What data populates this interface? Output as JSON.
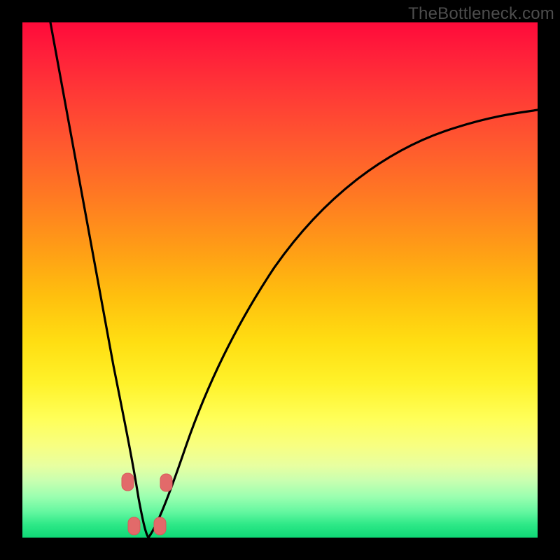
{
  "watermark": "TheBottleneck.com",
  "colors": {
    "frame": "#000000",
    "gradient_top": "#ff0a3a",
    "gradient_mid1": "#ff9d16",
    "gradient_mid2": "#ffff59",
    "gradient_bottom": "#0fd876",
    "curve": "#000000",
    "marker_fill": "#e26a6a",
    "marker_stroke": "#d85a5a"
  },
  "chart_data": {
    "type": "line",
    "title": "",
    "xlabel": "",
    "ylabel": "",
    "xlim": [
      0,
      100
    ],
    "ylim": [
      0,
      100
    ],
    "grid": false,
    "note": "Axes are unlabeled in the source image; values are normalized 0–100 estimated from pixel positions. Curve plunges from top-left to a minimum near x≈24 (y≈0) then rises asymptotically toward the upper right. Small rounded markers sit near the trough.",
    "series": [
      {
        "name": "curve-left",
        "x": [
          5.4,
          7,
          9,
          11,
          13,
          15,
          17,
          18.5,
          20,
          21.2,
          22,
          22.8,
          23.5,
          24
        ],
        "y": [
          100,
          91,
          79,
          67,
          55,
          43,
          31,
          22,
          14,
          8.5,
          5.2,
          2.6,
          1.0,
          0
        ]
      },
      {
        "name": "curve-right",
        "x": [
          24,
          26,
          28,
          30,
          33,
          36,
          40,
          45,
          50,
          56,
          62,
          69,
          76,
          84,
          92,
          100
        ],
        "y": [
          0,
          1.4,
          4.8,
          9.5,
          17,
          24,
          33,
          42,
          50,
          57,
          63,
          68.5,
          73,
          77,
          80.5,
          83
        ]
      }
    ],
    "markers": [
      {
        "x": 20.3,
        "y": 11.2
      },
      {
        "x": 27.7,
        "y": 11.0
      },
      {
        "x": 21.6,
        "y": 2.6
      },
      {
        "x": 26.6,
        "y": 2.6
      }
    ]
  }
}
